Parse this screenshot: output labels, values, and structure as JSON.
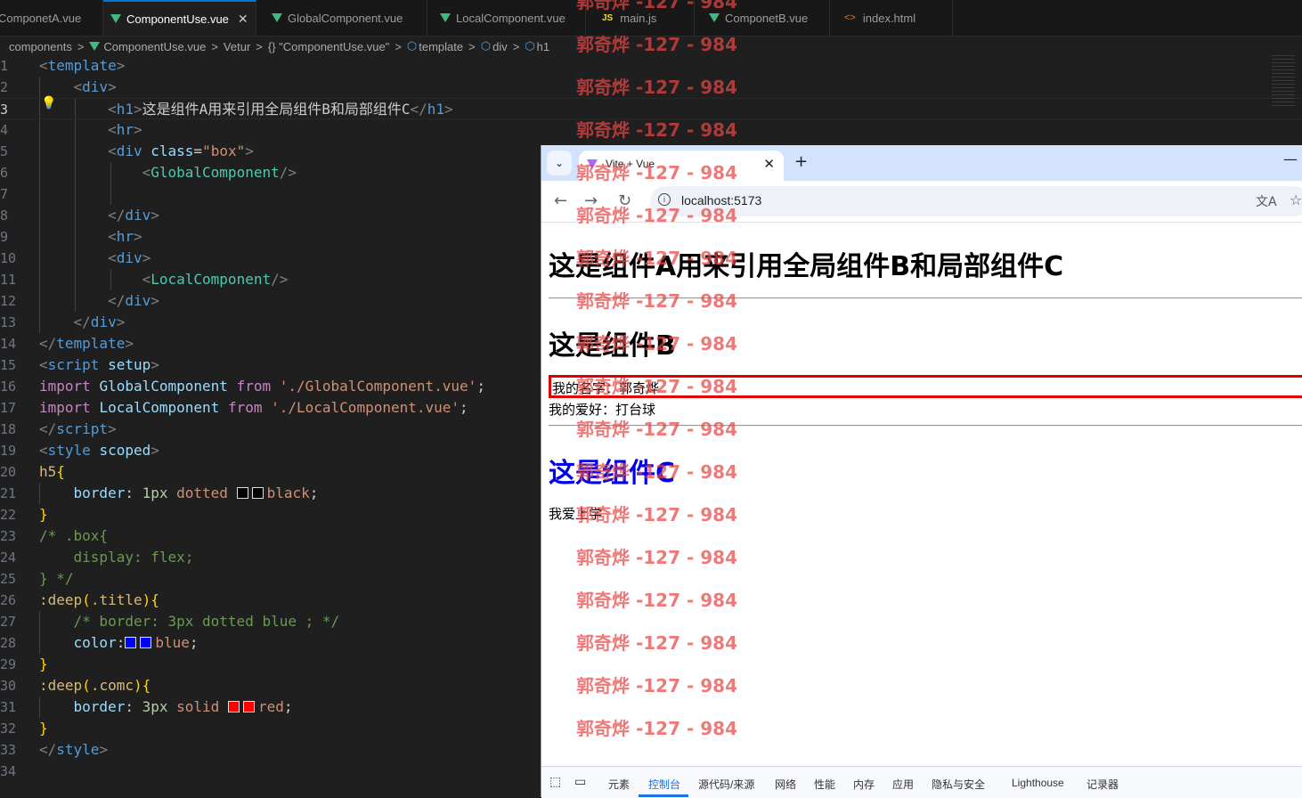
{
  "editor_tabs": [
    {
      "label": "ComponetA.vue",
      "icon": "vue-icon"
    },
    {
      "label": "ComponentUse.vue",
      "icon": "vue-icon",
      "close": "✕"
    },
    {
      "label": "GlobalComponent.vue",
      "icon": "vue-icon"
    },
    {
      "label": "LocalComponent.vue",
      "icon": "vue-icon"
    },
    {
      "label": "main.js",
      "icon": "js-icon",
      "icon_text": "JS"
    },
    {
      "label": "ComponetB.vue",
      "icon": "vue-icon"
    },
    {
      "label": "index.html",
      "icon": "html-icon",
      "icon_text": "<>"
    }
  ],
  "breadcrumbs": [
    "components",
    ">",
    "ComponentUse.vue",
    ">",
    "Vetur",
    ">",
    "{} \"ComponentUse.vue\"",
    ">",
    "template",
    ">",
    "div",
    ">",
    "h1"
  ],
  "editor": {
    "current_line": 3,
    "line_numbers": [
      "1",
      "2",
      "3",
      "4",
      "5",
      "6",
      "7",
      "8",
      "9",
      "10",
      "11",
      "12",
      "13",
      "14",
      "15",
      "16",
      "17",
      "18",
      "19",
      "20",
      "21",
      "22",
      "23",
      "24",
      "25",
      "26",
      "27",
      "28",
      "29",
      "30",
      "31",
      "32",
      "33",
      "34"
    ],
    "lines": [
      [
        [
          "tg",
          "<"
        ],
        [
          "tn",
          "template"
        ],
        [
          "tg",
          ">"
        ]
      ],
      [
        [
          "tx",
          "    "
        ],
        [
          "tg",
          "<"
        ],
        [
          "tn",
          "div"
        ],
        [
          "tg",
          ">"
        ]
      ],
      [
        [
          "tx",
          "        "
        ],
        [
          "tg",
          "<"
        ],
        [
          "tn",
          "h1"
        ],
        [
          "tg",
          ">"
        ],
        [
          "tx",
          "这是组件A用来引用全局组件B和局部组件C"
        ],
        [
          "tg",
          "</"
        ],
        [
          "tn",
          "h1"
        ],
        [
          "tg",
          ">"
        ]
      ],
      [
        [
          "tx",
          "        "
        ],
        [
          "tg",
          "<"
        ],
        [
          "tn",
          "hr"
        ],
        [
          "tg",
          ">"
        ]
      ],
      [
        [
          "tx",
          "        "
        ],
        [
          "tg",
          "<"
        ],
        [
          "tn",
          "div"
        ],
        [
          "tx",
          " "
        ],
        [
          "at",
          "class"
        ],
        [
          "tx",
          "="
        ],
        [
          "st",
          "\"box\""
        ],
        [
          "tg",
          ">"
        ]
      ],
      [
        [
          "tx",
          "            "
        ],
        [
          "tg",
          "<"
        ],
        [
          "comp",
          "GlobalComponent"
        ],
        [
          "tg",
          "/>"
        ]
      ],
      [
        [
          "tx",
          ""
        ]
      ],
      [
        [
          "tx",
          "        "
        ],
        [
          "tg",
          "</"
        ],
        [
          "tn",
          "div"
        ],
        [
          "tg",
          ">"
        ]
      ],
      [
        [
          "tx",
          "        "
        ],
        [
          "tg",
          "<"
        ],
        [
          "tn",
          "hr"
        ],
        [
          "tg",
          ">"
        ]
      ],
      [
        [
          "tx",
          "        "
        ],
        [
          "tg",
          "<"
        ],
        [
          "tn",
          "div"
        ],
        [
          "tg",
          ">"
        ]
      ],
      [
        [
          "tx",
          "            "
        ],
        [
          "tg",
          "<"
        ],
        [
          "comp",
          "LocalComponent"
        ],
        [
          "tg",
          "/>"
        ]
      ],
      [
        [
          "tx",
          "        "
        ],
        [
          "tg",
          "</"
        ],
        [
          "tn",
          "div"
        ],
        [
          "tg",
          ">"
        ]
      ],
      [
        [
          "tx",
          "    "
        ],
        [
          "tg",
          "</"
        ],
        [
          "tn",
          "div"
        ],
        [
          "tg",
          ">"
        ]
      ],
      [
        [
          "tg",
          "</"
        ],
        [
          "tn",
          "template"
        ],
        [
          "tg",
          ">"
        ]
      ],
      [
        [
          "tg",
          "<"
        ],
        [
          "tn",
          "script"
        ],
        [
          "tx",
          " "
        ],
        [
          "at",
          "setup"
        ],
        [
          "tg",
          ">"
        ]
      ],
      [
        [
          "kw",
          "import"
        ],
        [
          "tx",
          " "
        ],
        [
          "id",
          "GlobalComponent"
        ],
        [
          "tx",
          " "
        ],
        [
          "kw",
          "from"
        ],
        [
          "tx",
          " "
        ],
        [
          "st",
          "'./GlobalComponent.vue'"
        ],
        [
          "tx",
          ";"
        ]
      ],
      [
        [
          "kw",
          "import"
        ],
        [
          "tx",
          " "
        ],
        [
          "id",
          "LocalComponent"
        ],
        [
          "tx",
          " "
        ],
        [
          "kw",
          "from"
        ],
        [
          "tx",
          " "
        ],
        [
          "st",
          "'./LocalComponent.vue'"
        ],
        [
          "tx",
          ";"
        ]
      ],
      [
        [
          "tg",
          "</"
        ],
        [
          "tn",
          "script"
        ],
        [
          "tg",
          ">"
        ]
      ],
      [
        [
          "tg",
          "<"
        ],
        [
          "tn",
          "style"
        ],
        [
          "tx",
          " "
        ],
        [
          "at",
          "scoped"
        ],
        [
          "tg",
          ">"
        ]
      ],
      [
        [
          "sel",
          "h5"
        ],
        [
          "br",
          "{"
        ]
      ],
      [
        [
          "tx",
          "    "
        ],
        [
          "pr",
          "border"
        ],
        [
          "tx",
          ": "
        ],
        [
          "num",
          "1px"
        ],
        [
          "tx",
          " "
        ],
        [
          "vl",
          "dotted"
        ],
        [
          "tx",
          " "
        ],
        [
          "swatch",
          "#000000"
        ],
        [
          "vl",
          "black"
        ],
        [
          "tx",
          ";"
        ]
      ],
      [
        [
          "br",
          "}"
        ]
      ],
      [
        [
          "cm",
          "/* .box{"
        ]
      ],
      [
        [
          "cm",
          "    display: flex;"
        ]
      ],
      [
        [
          "cm",
          "} */"
        ]
      ],
      [
        [
          "sel",
          ":deep"
        ],
        [
          "br",
          "("
        ],
        [
          "sel",
          ".title"
        ],
        [
          "br",
          "){"
        ]
      ],
      [
        [
          "tx",
          "    "
        ],
        [
          "cm",
          "/* border: 3px dotted blue ; */"
        ]
      ],
      [
        [
          "tx",
          "    "
        ],
        [
          "pr",
          "color"
        ],
        [
          "tx",
          ":"
        ],
        [
          "swatch",
          "#0000ff"
        ],
        [
          "vl",
          "blue"
        ],
        [
          "tx",
          ";"
        ]
      ],
      [
        [
          "br",
          "}"
        ]
      ],
      [
        [
          "sel",
          ":deep"
        ],
        [
          "br",
          "("
        ],
        [
          "sel",
          ".comc"
        ],
        [
          "br",
          "){"
        ]
      ],
      [
        [
          "tx",
          "    "
        ],
        [
          "pr",
          "border"
        ],
        [
          "tx",
          ": "
        ],
        [
          "num",
          "3px"
        ],
        [
          "tx",
          " "
        ],
        [
          "vl",
          "solid"
        ],
        [
          "tx",
          " "
        ],
        [
          "swatch",
          "#ff0000"
        ],
        [
          "vl",
          "red"
        ],
        [
          "tx",
          ";"
        ]
      ],
      [
        [
          "br",
          "}"
        ]
      ],
      [
        [
          "tg",
          "</"
        ],
        [
          "tn",
          "style"
        ],
        [
          "tg",
          ">"
        ]
      ],
      [
        [
          "tx",
          ""
        ]
      ]
    ]
  },
  "browser": {
    "tab_title": "Vite + Vue",
    "tab_close": "✕",
    "new_tab": "+",
    "minimize": "—",
    "url": "localhost:5173",
    "page": {
      "h1": "这是组件A用来引用全局组件B和局部组件C",
      "component_b_title": "这是组件B",
      "name_line": "我的名字：郭奇烨",
      "hobby_line": "我的爱好：打台球",
      "component_c_title": "这是组件C",
      "c_text": "我爱上学"
    },
    "devtools_tabs": [
      "元素",
      "控制台",
      "源代码/来源",
      "网络",
      "性能",
      "内存",
      "应用",
      "隐私与安全",
      "Lighthouse",
      "记录器"
    ],
    "devtools_active": "控制台"
  },
  "watermark": "郭奇烨 -127 - 984",
  "colors": {
    "accent": "#0078d4",
    "watermark": "#e64646",
    "component_c": "#0000ee",
    "comc_border": "#e00000"
  }
}
